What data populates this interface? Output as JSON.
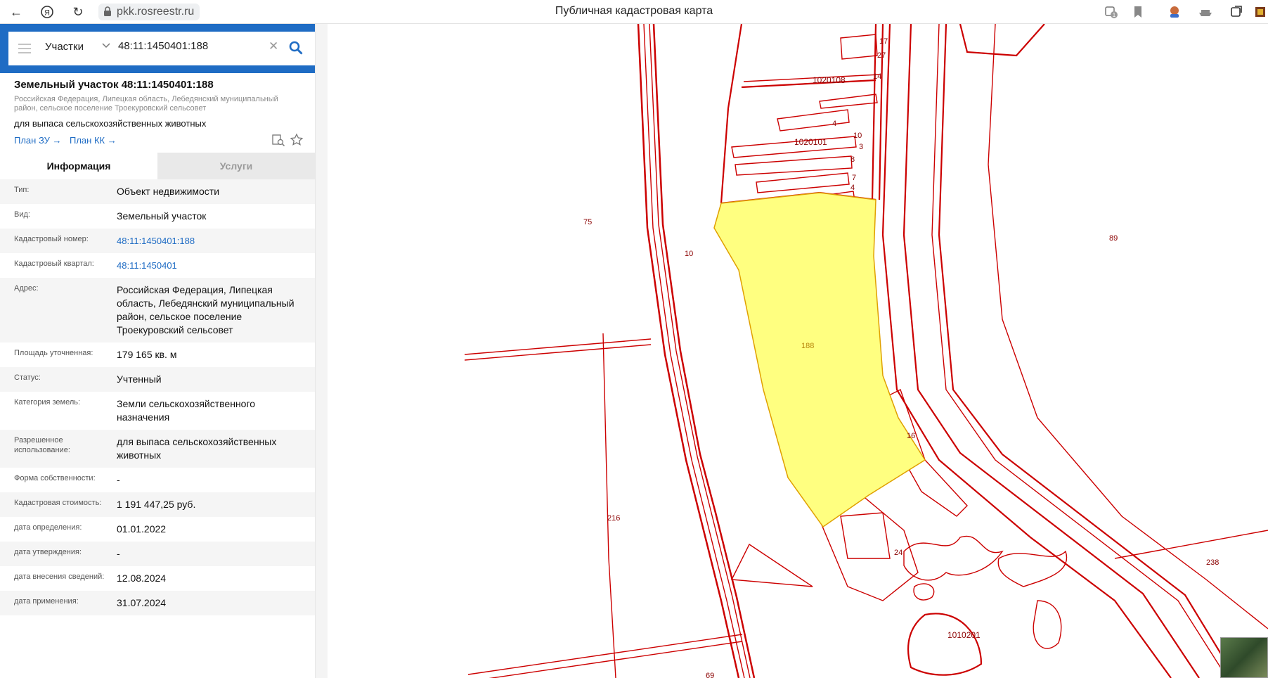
{
  "browser": {
    "url": "pkk.rosreestr.ru",
    "page_title": "Публичная кадастровая карта",
    "badge_count": "1"
  },
  "search": {
    "category": "Участки",
    "query": "48:11:1450401:188"
  },
  "parcel": {
    "title": "Земельный участок 48:11:1450401:188",
    "address": "Российская Федерация, Липецкая область, Лебедянский муниципальный район, сельское поселение Троекуровский сельсовет",
    "usage": "для выпаса сельскохозяйственных животных",
    "plan_zu": "План ЗУ →",
    "plan_kk": "План КК →"
  },
  "tabs": {
    "info": "Информация",
    "services": "Услуги"
  },
  "properties": [
    {
      "label": "Тип:",
      "value": "Объект недвижимости"
    },
    {
      "label": "Вид:",
      "value": "Земельный участок"
    },
    {
      "label": "Кадастровый номер:",
      "value": "48:11:1450401:188"
    },
    {
      "label": "Кадастровый квартал:",
      "value": "48:11:1450401"
    },
    {
      "label": "Адрес:",
      "value": "Российская Федерация, Липецкая область, Лебедянский муниципальный район, сельское поселение Троекуровский сельсовет"
    },
    {
      "label": "Площадь уточненная:",
      "value": "179 165 кв. м"
    },
    {
      "label": "Статус:",
      "value": "Учтенный"
    },
    {
      "label": "Категория земель:",
      "value": "Земли сельскохозяйственного назначения"
    },
    {
      "label": "Разрешенное использование:",
      "value": "для выпаса сельскохозяйственных животных"
    },
    {
      "label": "Форма собственности:",
      "value": "-"
    },
    {
      "label": "Кадастровая стоимость:",
      "value": "1 191 447,25 руб."
    },
    {
      "label": "дата определения:",
      "value": "01.01.2022"
    },
    {
      "label": "дата утверждения:",
      "value": "-"
    },
    {
      "label": "дата внесения сведений:",
      "value": "12.08.2024"
    },
    {
      "label": "дата применения:",
      "value": "31.07.2024"
    }
  ],
  "map_labels": {
    "l17": "17",
    "l27": "27",
    "l1020108": "1020108",
    "l14": "14",
    "l4a": "4",
    "l1020101": "1020101",
    "l10a": "10",
    "l3": "3",
    "l8": "8",
    "l7": "7",
    "l4b": "4",
    "l75": "75",
    "l10b": "10",
    "l89": "89",
    "l188": "188",
    "l16": "16",
    "l216": "216",
    "l24": "24",
    "l238": "238",
    "l1010201": "1010201",
    "l69": "69"
  },
  "colors": {
    "brand_blue": "#1f6cc4",
    "parcel_border": "#cc0000",
    "selected_fill": "#ffff80"
  }
}
